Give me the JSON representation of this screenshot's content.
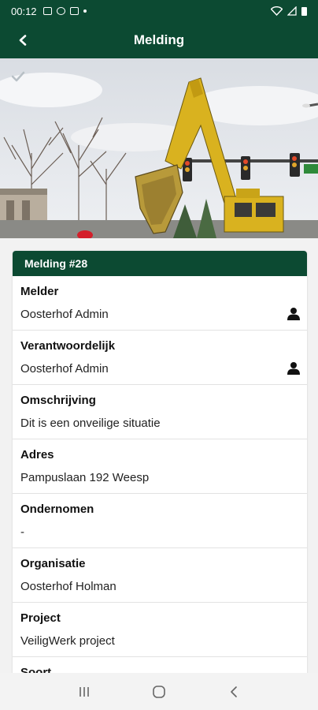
{
  "status_bar": {
    "time": "00:12"
  },
  "header": {
    "title": "Melding"
  },
  "card": {
    "title": "Melding #28",
    "fields": [
      {
        "label": "Melder",
        "value": "Oosterhof Admin"
      },
      {
        "label": "Verantwoordelijk",
        "value": "Oosterhof Admin"
      },
      {
        "label": "Omschrijving",
        "value": "Dit is een onveilige situatie"
      },
      {
        "label": "Adres",
        "value": "Pampuslaan 192 Weesp"
      },
      {
        "label": "Ondernomen",
        "value": "-"
      },
      {
        "label": "Organisatie",
        "value": "Oosterhof Holman"
      },
      {
        "label": "Project",
        "value": "VeiligWerk project"
      },
      {
        "label": "Soort",
        "value": ""
      }
    ]
  },
  "colors": {
    "primary": "#0c4a32",
    "background": "#f2f2f2",
    "card": "#ffffff"
  },
  "icons": {
    "back": "arrow-left-icon",
    "check": "check-icon",
    "user": "user-icon",
    "nav_recent": "recent-apps-icon",
    "nav_home": "home-icon",
    "nav_back": "back-chevron-icon"
  }
}
